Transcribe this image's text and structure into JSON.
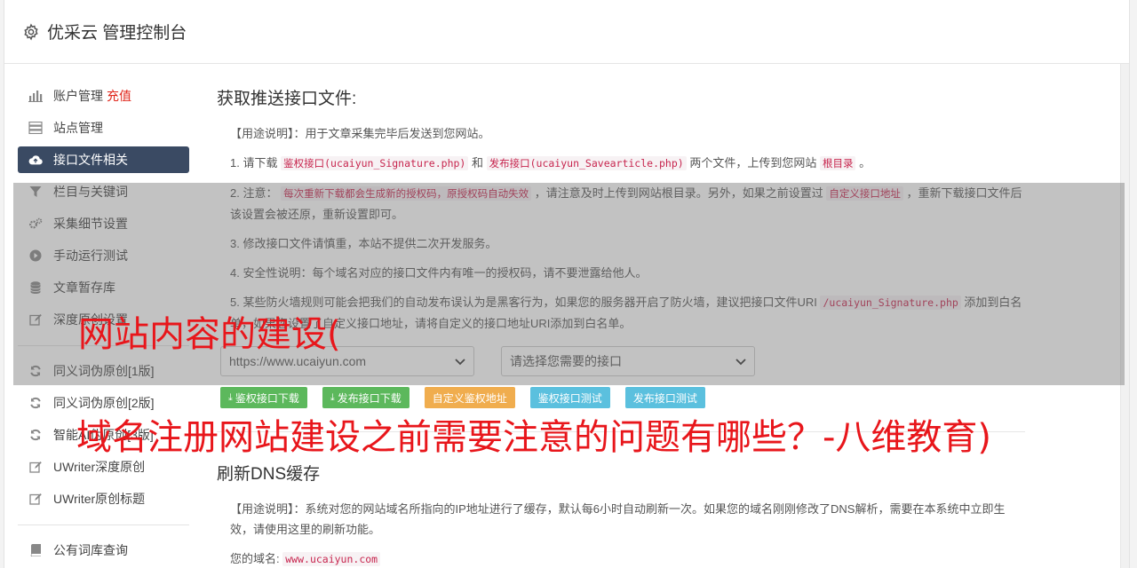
{
  "header": {
    "title": "优采云 管理控制台",
    "icon": "gear-icon"
  },
  "sidebar": {
    "items": [
      {
        "label": "账户管理",
        "badge": "充值",
        "icon": "bar-chart-icon"
      },
      {
        "label": "站点管理",
        "icon": "server-icon"
      },
      {
        "label": "接口文件相关",
        "icon": "cloud-upload-icon",
        "active": true
      },
      {
        "label": "栏目与关键词",
        "icon": "filter-icon"
      },
      {
        "label": "采集细节设置",
        "icon": "cogs-icon"
      },
      {
        "label": "手动运行测试",
        "icon": "play-circle-icon"
      },
      {
        "label": "文章暂存库",
        "icon": "database-icon"
      },
      {
        "label": "深度原创设置",
        "icon": "edit-icon"
      }
    ],
    "items2": [
      {
        "label": "同义词伪原创[1版]",
        "icon": "refresh-icon"
      },
      {
        "label": "同义词伪原创[2版]",
        "icon": "refresh-icon"
      },
      {
        "label": "智能AI伪原创[3版]",
        "icon": "refresh-icon"
      },
      {
        "label": "UWriter深度原创",
        "icon": "edit-icon"
      },
      {
        "label": "UWriter原创标题",
        "icon": "edit-icon"
      }
    ],
    "items3": [
      {
        "label": "公有词库查询",
        "icon": "book-icon"
      }
    ]
  },
  "main": {
    "section1": {
      "title": "获取推送接口文件:",
      "usage": "【用途说明】：用于文章采集完毕后发送到您网站。",
      "p1": {
        "a": "1. 请下载",
        "code1": "鉴权接口(ucaiyun_Signature.php)",
        "b": "和",
        "code2": "发布接口(ucaiyun_Savearticle.php)",
        "c": "两个文件，上传到您网站",
        "code3": "根目录",
        "d": "。"
      },
      "p2": {
        "a": "2. 注意：",
        "code1": "每次重新下载都会生成新的授权码，原授权码自动失效",
        "b": "，请注意及时上传到网站根目录。另外，如果之前设置过",
        "code2": "自定义接口地址",
        "c": "，重新下载接口文件后该设置会被还原，重新设置即可。"
      },
      "p3": "3. 修改接口文件请慎重，本站不提供二次开发服务。",
      "p4": "4. 安全性说明：每个域名对应的接口文件内有唯一的授权码，请不要泄露给他人。",
      "p5": {
        "a": "5. 某些防火墙规则可能会把我们的自动发布误认为是黑客行为，如果您的服务器开启了防火墙，建议把接口文件URI",
        "code1": "/ucaiyun_Signature.php",
        "b": "添加到白名单，如果您设置了自定义接口地址，请将自定义的接口地址URI添加到白名单。"
      },
      "select_site": "https://www.ucaiyun.com",
      "select_api": "请选择您需要的接口",
      "buttons": {
        "auth_download": "鉴权接口下载",
        "publish_download": "发布接口下载",
        "custom_auth_url": "自定义鉴权地址",
        "auth_test": "鉴权接口测试",
        "publish_test": "发布接口测试"
      }
    },
    "section2": {
      "title": "刷新DNS缓存",
      "usage": "【用途说明】：系统对您的网站域名所指向的IP地址进行了缓存，默认每6小时自动刷新一次。如果您的域名刚刚修改了DNS解析，需要在本系统中立即生效，请使用这里的刷新功能。",
      "domain_label": "您的域名:",
      "domain_value": "www.ucaiyun.com"
    }
  },
  "watermark": {
    "line1": "网站内容的建设(",
    "line2": "域名注册网站建设之前需要注意的问题有哪些？-八维教育)"
  },
  "colors": {
    "accent": "#3a4a63",
    "danger": "#e0251a",
    "green": "#5cb85c",
    "orange": "#f0ad4e",
    "blue": "#5bc0de",
    "watermark": "#e8161b"
  }
}
